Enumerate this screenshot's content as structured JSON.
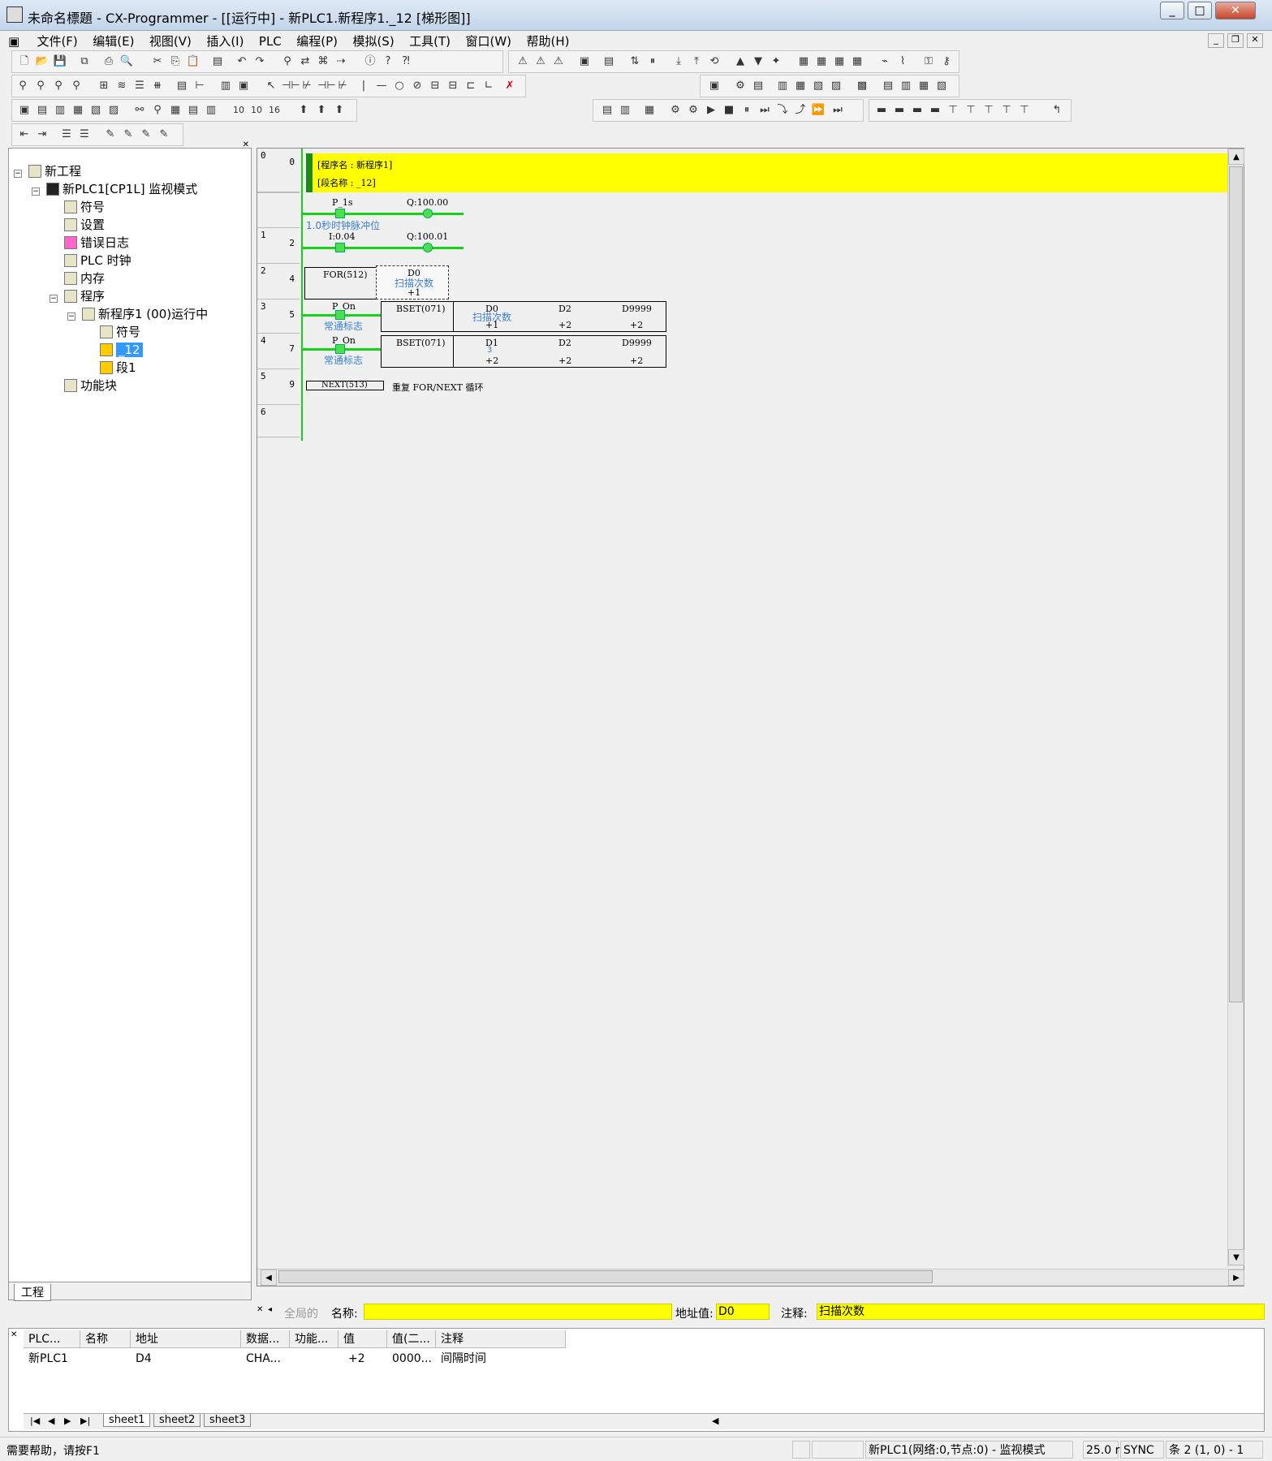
{
  "window": {
    "title": "未命名標題 - CX-Programmer - [[运行中] - 新PLC1.新程序1._12 [梯形图]]",
    "minimize": "_",
    "maximize": "□",
    "close": "✕"
  },
  "menu": [
    "文件(F)",
    "编辑(E)",
    "视图(V)",
    "插入(I)",
    "PLC",
    "编程(P)",
    "模拟(S)",
    "工具(T)",
    "窗口(W)",
    "帮助(H)"
  ],
  "tree": {
    "root": "新工程",
    "plc": "新PLC1[CP1L] 监视模式",
    "symbols": "符号",
    "settings": "设置",
    "error_log": "错误日志",
    "plc_clock": "PLC 时钟",
    "memory": "内存",
    "programs": "程序",
    "program1": "新程序1 (00)运行中",
    "prog_symbols": "符号",
    "section_selected": "_12",
    "section1": "段1",
    "function_blocks": "功能块",
    "tab": "工程"
  },
  "ladder": {
    "header_program": "[程序名 : 新程序1]",
    "header_section": "[段名称 : _12]",
    "rungs": [
      {
        "rung": "0",
        "step": "0"
      },
      {
        "rung": "1",
        "step": "2"
      },
      {
        "rung": "2",
        "step": "4"
      },
      {
        "rung": "3",
        "step": "5"
      },
      {
        "rung": "4",
        "step": "7"
      },
      {
        "rung": "5",
        "step": "9"
      },
      {
        "rung": "6",
        "step": ""
      }
    ],
    "r0_contact": "P_1s",
    "r0_coil": "Q:100.00",
    "r0_comment": "1.0秒时钟脉冲位",
    "r1_contact": "I:0.04",
    "r1_coil": "Q:100.01",
    "r2_instr": "FOR(512)",
    "r2_op": "D0",
    "r2_op_comment": "扫描次数",
    "r2_op_value": "+1",
    "r3_contact": "P_On",
    "r3_comment": "常通标志",
    "r3_instr": "BSET(071)",
    "r3_op1": "D0",
    "r3_op1_comment": "扫描次数",
    "r3_op1_value": "+1",
    "r3_op2": "D2",
    "r3_op2_value": "+2",
    "r3_op3": "D9999",
    "r3_op3_value": "+2",
    "r4_contact": "P_On",
    "r4_comment": "常通标志",
    "r4_instr": "BSET(071)",
    "r4_op1": "D1",
    "r4_op1_comment": "3",
    "r4_op1_value": "+2",
    "r4_op2": "D2",
    "r4_op2_value": "+2",
    "r4_op3": "D9999",
    "r4_op3_value": "+2",
    "r5_instr": "NEXT(513)",
    "r5_comment": "重复 FOR/NEXT 循环"
  },
  "propbar": {
    "global": "全局的",
    "name_label": "名称:",
    "name_value": "",
    "addr_label": "地址值:",
    "addr_value": "D0",
    "comment_label": "注释:",
    "comment_value": "扫描次数"
  },
  "watch": {
    "headers": [
      "PLC...",
      "名称",
      "地址",
      "数据...",
      "功能...",
      "值",
      "值(二...",
      "注释"
    ],
    "rows": [
      [
        "新PLC1",
        "",
        "D4",
        "CHA...",
        "",
        "+2",
        "0000...",
        "间隔时间"
      ]
    ],
    "sheets": [
      "sheet1",
      "sheet2",
      "sheet3"
    ]
  },
  "status": {
    "help": "需要帮助，请按F1",
    "connection": "新PLC1(网络:0,节点:0) - 监视模式",
    "scan": "25.0 r",
    "sync": "SYNC",
    "pos": "条 2 (1, 0) - 1"
  },
  "colors": {
    "header_yellow": "#ffff00",
    "wire_green": "#1ad11a",
    "comment_blue": "#3a7fd0",
    "selection": "#3399ff"
  }
}
